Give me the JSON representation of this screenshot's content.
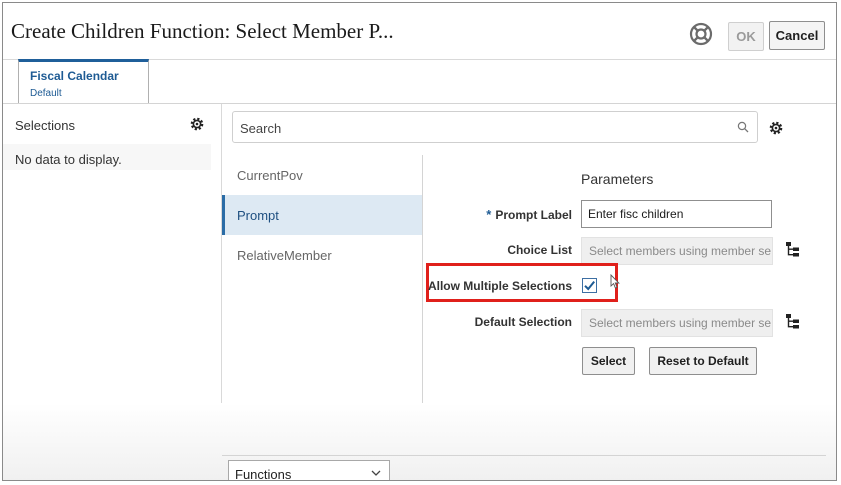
{
  "dialog": {
    "title": "Create Children Function: Select Member P...",
    "ok_label": "OK",
    "cancel_label": "Cancel",
    "help_icon": "help-lifebuoy-icon"
  },
  "tabs": [
    {
      "label": "Fiscal Calendar",
      "sublabel": "Default"
    }
  ],
  "selections": {
    "label": "Selections",
    "empty_text": "No data to display."
  },
  "search": {
    "placeholder": "Search"
  },
  "nav": {
    "items": [
      "CurrentPov",
      "Prompt",
      "RelativeMember"
    ],
    "active": "Prompt"
  },
  "parameters": {
    "heading": "Parameters",
    "prompt_label": "Prompt Label",
    "prompt_value": "Enter fisc children",
    "choice_list_label": "Choice List",
    "choice_list_placeholder": "Select members using member se",
    "allow_multiple_label": "Allow Multiple Selections",
    "allow_multiple_checked": true,
    "default_selection_label": "Default Selection",
    "default_selection_placeholder": "Select members using member se",
    "select_button": "Select",
    "reset_button": "Reset to Default"
  },
  "footer": {
    "functions_label": "Functions"
  },
  "colors": {
    "accent": "#1e5b94",
    "highlight": "#e0201b",
    "active_bg": "#dde9f3"
  }
}
